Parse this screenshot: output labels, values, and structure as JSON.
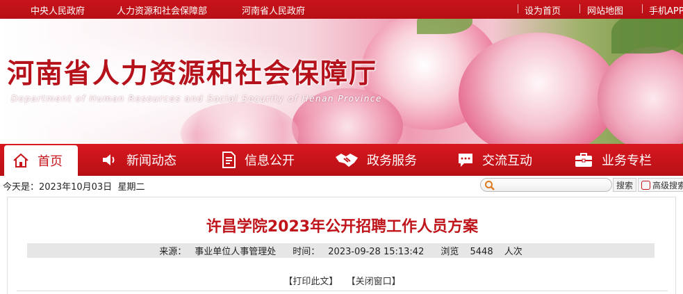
{
  "colors": {
    "brand_red": "#c8141b",
    "title_red": "#c0141b"
  },
  "topbar": {
    "left_links": [
      "中央人民政府",
      "人力资源和社会保障部",
      "河南省人民政府"
    ],
    "right_links": [
      "设为首页",
      "网站地图",
      "手机APP"
    ]
  },
  "banner": {
    "title": "河南省人力资源和社会保障厅",
    "subtitle": "Department of Human Resources and Social Security of Henan Province"
  },
  "nav": {
    "items": [
      {
        "label": "首页",
        "icon": "home-icon",
        "active": true
      },
      {
        "label": "新闻动态",
        "icon": "speaker-icon",
        "active": false
      },
      {
        "label": "信息公开",
        "icon": "document-icon",
        "active": false
      },
      {
        "label": "政务服务",
        "icon": "handshake-icon",
        "active": false
      },
      {
        "label": "交流互动",
        "icon": "chat-icon",
        "active": false
      },
      {
        "label": "业务专栏",
        "icon": "briefcase-icon",
        "active": false
      }
    ]
  },
  "date_bar": {
    "prefix": "今天是：",
    "date": "2023年10月03日",
    "weekday": "星期二"
  },
  "search": {
    "placeholder": "",
    "button_label": "搜索",
    "advanced_label": "高级搜索"
  },
  "article": {
    "title": "许昌学院2023年公开招聘工作人员方案",
    "source_label": "来源：",
    "source": "事业单位人事管理处",
    "time_label": "时间：",
    "time": "2023-09-28 15:13:42",
    "views_label": "浏览",
    "views": "5448",
    "views_unit": "人次",
    "print_label": "【打印此文】",
    "close_label": "【关闭窗口】"
  }
}
